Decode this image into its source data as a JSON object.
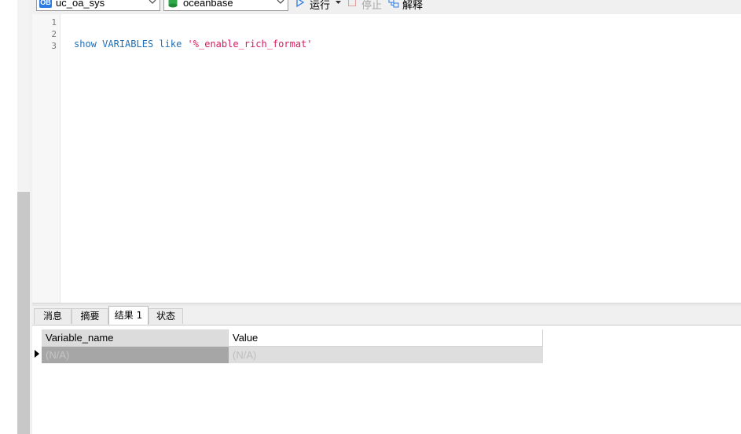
{
  "toolbar": {
    "connection": {
      "badge": "OB",
      "value": "uc_oa_sys"
    },
    "database": {
      "value": "oceanbase"
    },
    "run_label": "运行",
    "stop_label": "停止",
    "explain_label": "解释"
  },
  "editor": {
    "line_numbers": [
      "1",
      "2",
      "3"
    ],
    "code": {
      "kw1": "show",
      "kw2": "VARIABLES",
      "kw3": "like",
      "literal": "'%_enable_rich_format'"
    }
  },
  "tabs": [
    {
      "label": "消息"
    },
    {
      "label": "摘要"
    },
    {
      "label": "结果 1"
    },
    {
      "label": "状态"
    }
  ],
  "active_tab": "结果 1",
  "grid": {
    "columns": [
      "Variable_name",
      "Value"
    ],
    "rows": [
      [
        "(N/A)",
        "(N/A)"
      ]
    ]
  }
}
